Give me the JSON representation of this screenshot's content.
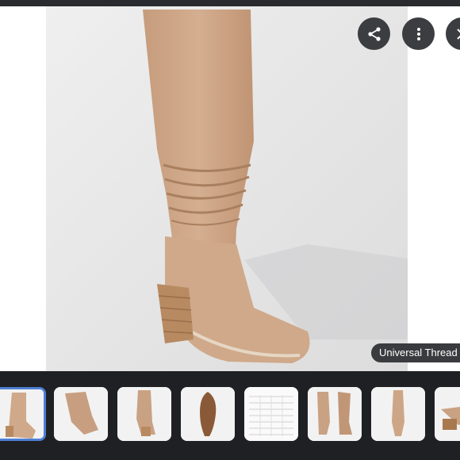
{
  "viewer": {
    "main_image": {
      "alt": "Tan suede knee-high slouch boot with stacked block heel",
      "background": "#e9e9ea",
      "suede_color": "#cfa98a",
      "heel_color": "#b88a62"
    },
    "buttons": {
      "share": {
        "icon": "share-icon",
        "label": "Share"
      },
      "more": {
        "icon": "more-vertical-icon",
        "label": "More options"
      },
      "close": {
        "icon": "close-icon",
        "label": "Close"
      }
    },
    "caption": "Universal Thread"
  },
  "thumbnails": [
    {
      "icon": "boot-side-view",
      "selected": true
    },
    {
      "icon": "boot-angled-view",
      "selected": false
    },
    {
      "icon": "boot-back-view",
      "selected": false
    },
    {
      "icon": "boot-sole-view",
      "selected": false
    },
    {
      "icon": "size-chart",
      "selected": false
    },
    {
      "icon": "boot-pair-view",
      "selected": false
    },
    {
      "icon": "boot-front-view",
      "selected": false
    },
    {
      "icon": "boot-heel-detail",
      "selected": false
    }
  ],
  "colors": {
    "bar": "#1f2023",
    "button": "#3c3d40",
    "selection": "#4d7fd6"
  }
}
